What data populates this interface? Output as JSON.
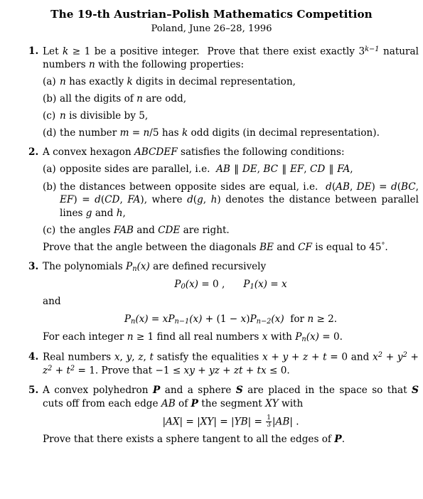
{
  "header": {
    "title": "The 19-th Austrian–Polish Mathematics Competition",
    "subtitle": "Poland, June 26–28, 1996"
  },
  "problems": [
    {
      "number": "1.",
      "intro_before_sup": "Let k ≥ 1 be a positive integer. Prove that there exist exactly 3",
      "intro_sup": "k−1",
      "intro_after_sup": "natural numbers n with the following properties:",
      "subitems": [
        {
          "label": "(a)",
          "text": "n has exactly k digits in decimal representation,"
        },
        {
          "label": "(b)",
          "text": "all the digits of n are odd,"
        },
        {
          "label": "(c)",
          "text": "n is divisible by 5,"
        },
        {
          "label": "(d)",
          "text": "the number m = n/5 has k odd digits (in decimal representation)."
        }
      ]
    },
    {
      "number": "2.",
      "intro": "A convex hexagon ABCDEF satisfies the following conditions:",
      "subitems": [
        {
          "label": "(a)",
          "text": "opposite sides are parallel, i.e.  AB ‖ DE, BC ‖ EF, CD ‖ FA,"
        },
        {
          "label": "(b)",
          "text": "the distances between opposite sides are equal, i.e.  d(AB, DE) = d(BC, EF) = d(CD, FA), where d(g, h) denotes the distance between parallel lines g and h,"
        },
        {
          "label": "(c)",
          "text": "the angles FAB and CDE are right."
        }
      ],
      "conclusion": "Prove that the angle between the diagonals BE and CF is equal to 45°."
    },
    {
      "number": "3.",
      "intro": "The polynomials Pₙ(x) are defined recursively",
      "display1_left": "P",
      "display1_sub": "0",
      "display1_rest": "(x) = 0 ,",
      "display1_left2": "P",
      "display1_sub2": "1",
      "display1_rest2": "(x) = x",
      "and_word": "and",
      "display2": "Pₙ(x) = xPₙ₋₁(x) + (1 − x)Pₙ₋₂(x)  for n ≥ 2.",
      "conclusion": "For each integer n ≥ 1 find all real numbers x with Pₙ(x) = 0."
    },
    {
      "number": "4.",
      "line1": "Real numbers x, y, z, t satisfy the equalities x + y + z + t = 0 and",
      "line2": "x² + y² + z² + t² = 1. Prove that −1 ≤ xy + yz + zt + tx ≤ 0."
    },
    {
      "number": "5.",
      "line1": "A convex polyhedron 𝒫 and a sphere 𝒮 are placed in the space so that",
      "line2": "𝒮 cuts off from each edge AB of 𝒫 the segment XY with",
      "display": "|AX| = |XY| = |YB| = ⅓|AB| .",
      "conclusion": "Prove that there exists a sphere tangent to all the edges of 𝒫."
    }
  ],
  "symbols": {
    "parallel": "‖",
    "geq": "≥",
    "leq": "≤",
    "minus": "−",
    "degree": "°",
    "endash": "–"
  },
  "colors": {
    "text": "#000000",
    "background": "#ffffff"
  }
}
